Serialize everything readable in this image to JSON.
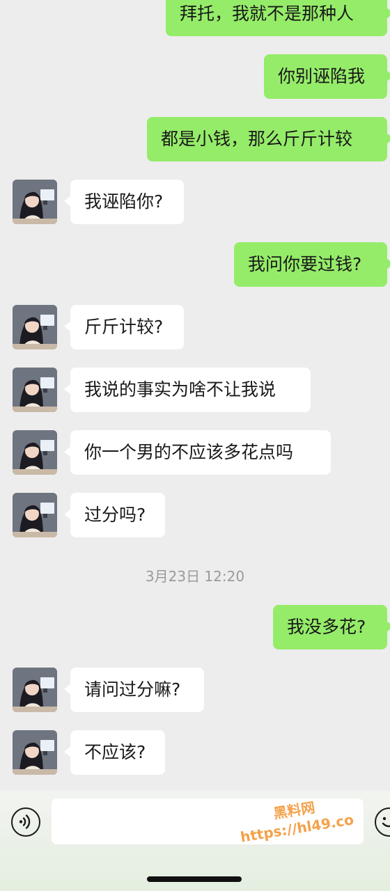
{
  "messages": [
    {
      "direction": "out",
      "text": "拜托，我就不是那种人"
    },
    {
      "direction": "out",
      "text": "你别诬陷我"
    },
    {
      "direction": "out",
      "text": "都是小钱，那么斤斤计较"
    },
    {
      "direction": "in",
      "text": "我诬陷你?"
    },
    {
      "direction": "out",
      "text": "我问你要过钱?"
    },
    {
      "direction": "in",
      "text": "斤斤计较?"
    },
    {
      "direction": "in",
      "text": "我说的事实为啥不让我说"
    },
    {
      "direction": "in",
      "text": "你一个男的不应该多花点吗"
    },
    {
      "direction": "in",
      "text": "过分吗?"
    },
    {
      "direction": "out",
      "text": "我没多花?"
    },
    {
      "direction": "in",
      "text": "请问过分嘛?"
    },
    {
      "direction": "in",
      "text": "不应该?"
    }
  ],
  "timestamp": "3月23日 12:20",
  "input": {
    "value": "",
    "placeholder": ""
  },
  "icons": {
    "voice": "voice-wave-icon",
    "emoji": "smiley-icon",
    "avatar": "anime-girl-avatar"
  },
  "colors": {
    "outgoing_bubble": "#95ec69",
    "incoming_bubble": "#ffffff",
    "background": "#ededed",
    "watermark": "#f5a14a"
  },
  "watermark": {
    "line1": "黑料网",
    "line2": "https://hl49.co"
  }
}
